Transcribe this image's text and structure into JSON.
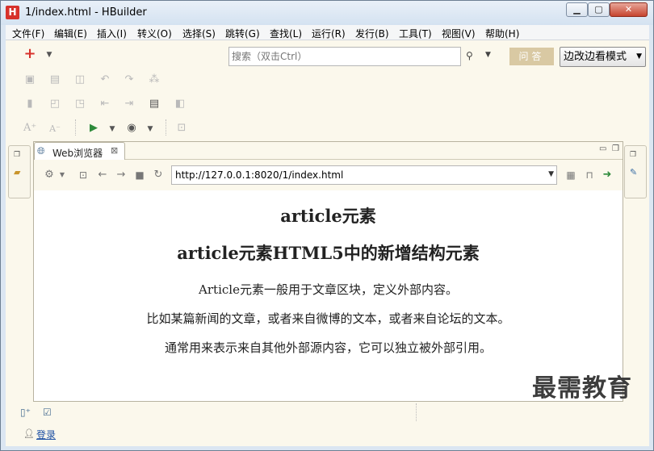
{
  "window": {
    "title": "1/index.html  -  HBuilder",
    "logo_letter": "H",
    "min_symbol": "▁",
    "max_symbol": "▢",
    "close_symbol": "✕"
  },
  "menu": [
    "文件(F)",
    "编辑(E)",
    "插入(I)",
    "转义(O)",
    "选择(S)",
    "跳转(G)",
    "查找(L)",
    "运行(R)",
    "发行(B)",
    "工具(T)",
    "视图(V)",
    "帮助(H)"
  ],
  "toolbar": {
    "new_icon": "+",
    "new_dropdown": "▼",
    "search_placeholder": "搜索（双击Ctrl）",
    "search_icon": "⚲",
    "search_dropdown": "▼",
    "answer_label": "问答",
    "mode_label": "边改边看模式",
    "mode_caret": "▼"
  },
  "editor": {
    "tab_label": "Web浏览器",
    "tab_close": "⊠",
    "url": "http://127.0.0.1:8020/1/index.html",
    "url_dropdown": "▼"
  },
  "page": {
    "heading1": "article元素",
    "heading2": "article元素HTML5中的新增结构元素",
    "paragraphs": [
      "Article元素一般用于文章区块，定义外部内容。",
      "比如某篇新闻的文章，或者来自微博的文本，或者来自论坛的文本。",
      "通常用来表示来自其他外部源内容，它可以独立被外部引用。"
    ]
  },
  "status": {
    "login_label": "登录",
    "watermark": "最需教育"
  }
}
